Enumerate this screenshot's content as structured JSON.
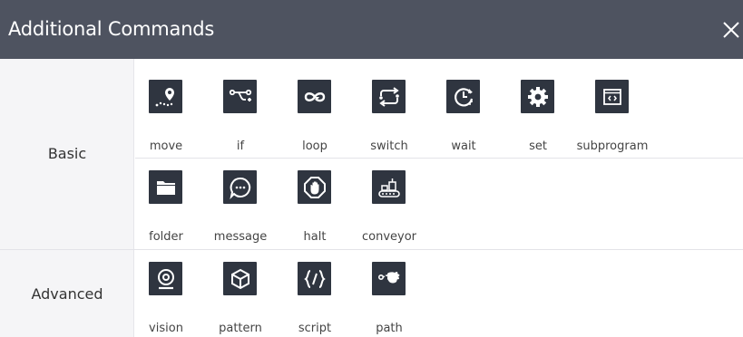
{
  "dialog": {
    "title": "Additional Commands",
    "close_icon": "close-icon",
    "colors": {
      "titlebar": "#4e5360",
      "tile": "#2f3540",
      "category_bg": "#f5f5f7"
    }
  },
  "categories": {
    "basic": {
      "label": "Basic",
      "row1": [
        {
          "label": "move",
          "icon": "move-icon"
        },
        {
          "label": "if",
          "icon": "if-branch-icon"
        },
        {
          "label": "loop",
          "icon": "loop-icon"
        },
        {
          "label": "switch",
          "icon": "switch-icon"
        },
        {
          "label": "wait",
          "icon": "wait-clock-icon"
        },
        {
          "label": "set",
          "icon": "gear-icon"
        },
        {
          "label": "subprogram",
          "icon": "subprogram-icon"
        }
      ],
      "row2": [
        {
          "label": "folder",
          "icon": "folder-icon"
        },
        {
          "label": "message",
          "icon": "message-icon"
        },
        {
          "label": "halt",
          "icon": "halt-hand-icon"
        },
        {
          "label": "conveyor",
          "icon": "conveyor-icon"
        }
      ]
    },
    "advanced": {
      "label": "Advanced",
      "row1": [
        {
          "label": "vision",
          "icon": "camera-icon"
        },
        {
          "label": "pattern",
          "icon": "cube-icon"
        },
        {
          "label": "script",
          "icon": "code-braces-icon"
        },
        {
          "label": "path",
          "icon": "path-hand-icon"
        }
      ]
    }
  }
}
